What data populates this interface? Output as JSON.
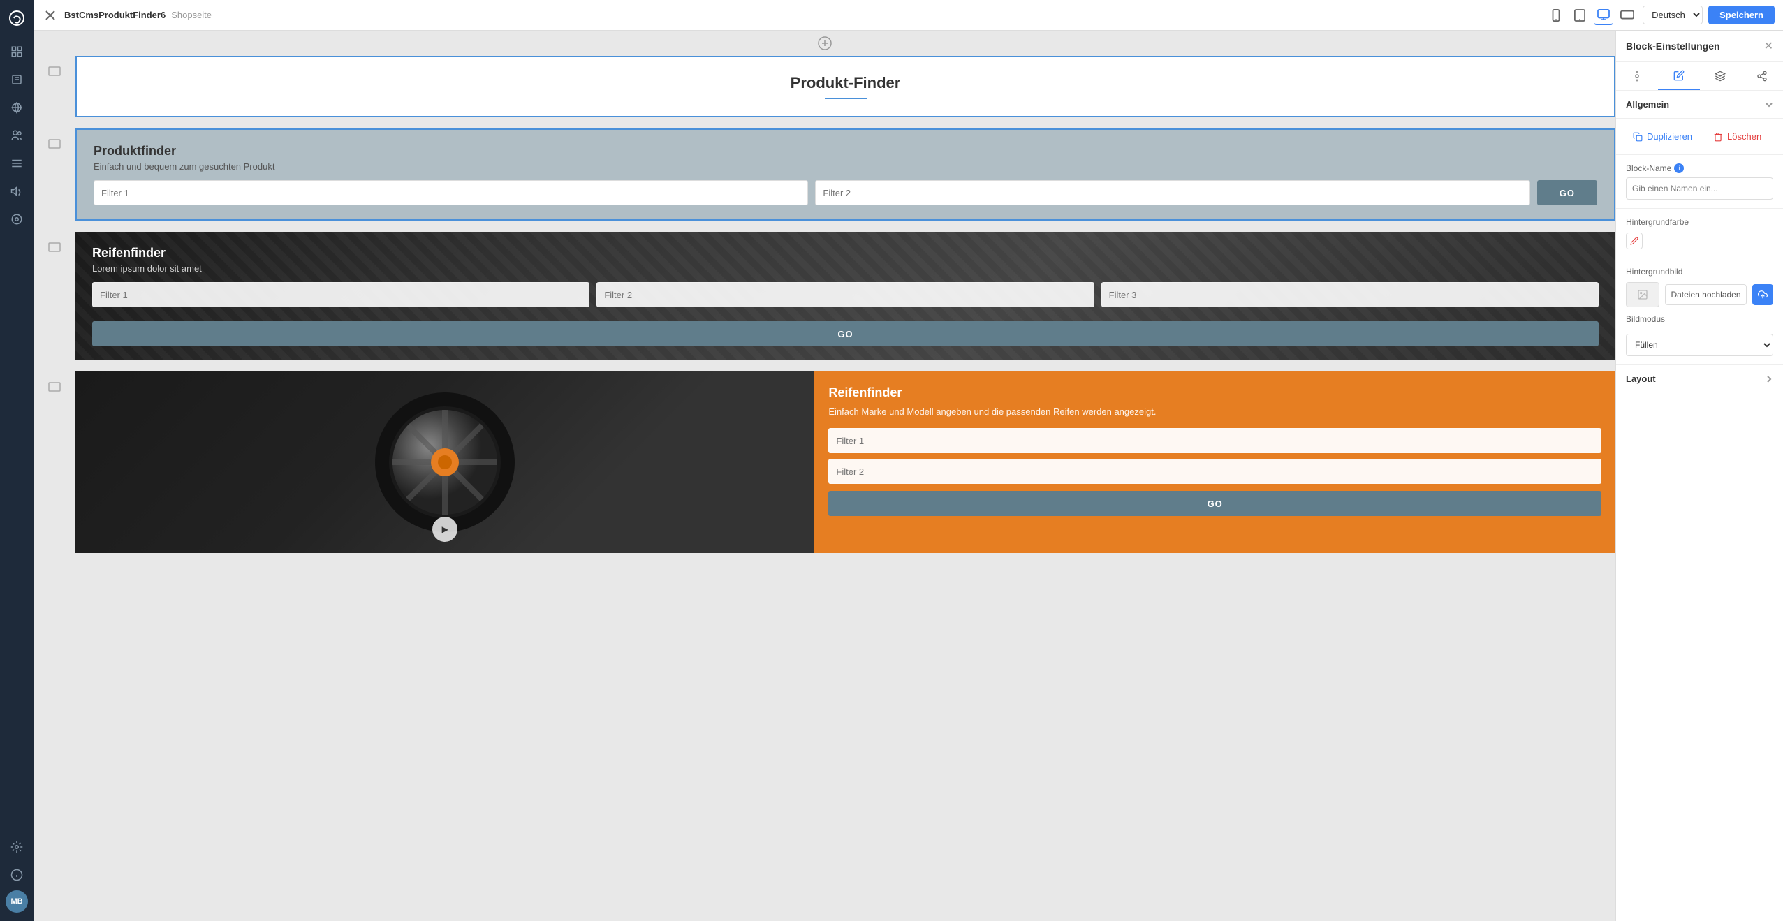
{
  "app": {
    "logo": "G",
    "tab_title": "BstCmsProduktFinder6",
    "tab_subtitle": "Shopseite",
    "language": "Deutsch",
    "save_label": "Speichern"
  },
  "devices": [
    {
      "id": "mobile",
      "icon": "📱",
      "active": false
    },
    {
      "id": "tablet",
      "icon": "⬜",
      "active": false
    },
    {
      "id": "desktop",
      "icon": "🖥",
      "active": true
    },
    {
      "id": "wide",
      "icon": "▦",
      "active": false
    }
  ],
  "sidebar": {
    "items": [
      {
        "id": "logo",
        "icon": "G",
        "active": false
      },
      {
        "id": "layers",
        "icon": "◫",
        "active": false
      },
      {
        "id": "pages",
        "icon": "⊡",
        "active": false
      },
      {
        "id": "shop",
        "icon": "◻",
        "active": false
      },
      {
        "id": "users",
        "icon": "👤",
        "active": false
      },
      {
        "id": "content",
        "icon": "≡",
        "active": false
      },
      {
        "id": "marketing",
        "icon": "📢",
        "active": false
      },
      {
        "id": "analytics",
        "icon": "◎",
        "active": false
      },
      {
        "id": "settings",
        "icon": "⚙",
        "active": false
      },
      {
        "id": "info",
        "icon": "ℹ",
        "active": false
      }
    ],
    "avatar": "MB"
  },
  "blocks": [
    {
      "id": "block1",
      "type": "header",
      "title": "Produkt-Finder",
      "selected": false
    },
    {
      "id": "block2",
      "type": "produktfinder",
      "title": "Produktfinder",
      "subtitle": "Einfach und bequem zum gesuchten Produkt",
      "filter1": "Filter 1",
      "filter2": "Filter 2",
      "go_label": "GO",
      "selected": true
    },
    {
      "id": "block3",
      "type": "reifenfinder-dark",
      "title": "Reifenfinder",
      "subtitle": "Lorem ipsum dolor sit amet",
      "filter1": "Filter 1",
      "filter2": "Filter 2",
      "filter3": "Filter 3",
      "go_label": "GO",
      "selected": false
    },
    {
      "id": "block4",
      "type": "reifenfinder-orange",
      "title": "Reifenfinder",
      "subtitle": "Einfach Marke und Modell angeben und die passenden Reifen werden angezeigt.",
      "filter1": "Filter 1",
      "filter2": "Filter 2",
      "go_label": "GO",
      "selected": false
    }
  ],
  "right_panel": {
    "title": "Block-Einstellungen",
    "sections": {
      "allgemein": {
        "label": "Allgemein",
        "expanded": true
      },
      "duplicate_label": "Duplizieren",
      "delete_label": "Löschen",
      "block_name_label": "Block-Name",
      "block_name_placeholder": "Gib einen Namen ein...",
      "bg_color_label": "Hintergrundfarbe",
      "bg_image_label": "Hintergrundbild",
      "upload_label": "Dateien hochladen",
      "image_mode_label": "Bildmodus",
      "image_mode_value": "Füllen",
      "layout_label": "Layout"
    }
  },
  "add_block_icon": "+"
}
